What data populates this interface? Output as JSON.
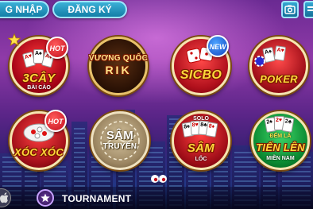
{
  "header": {
    "login_label": "G NHẬP",
    "register_label": "ĐĂNG KÝ"
  },
  "games": [
    {
      "id": "3cay",
      "title": "3CÂY",
      "subtitle": "BÀI CÀO",
      "badge": "HOT"
    },
    {
      "id": "vuong-quoc-rik",
      "title": "VƯƠNG QUỐC",
      "subtitle": "RIK"
    },
    {
      "id": "sicbo",
      "title": "SICBO",
      "badge": "NEW"
    },
    {
      "id": "poker",
      "title": "POKER"
    },
    {
      "id": "xoc-xoc",
      "title": "XÓC XÓC",
      "badge": "HOT"
    },
    {
      "id": "sam-truyen",
      "title": "SÂM",
      "subtitle": "TRUYỀN"
    },
    {
      "id": "sam-loc",
      "title": "SÂM",
      "subtitle": "LỐC",
      "top_label": "SOLO"
    },
    {
      "id": "tien-len",
      "title": "TIẾN LÊN",
      "subtitle": "MIỀN NAM",
      "top_label": "ĐẾM LÁ"
    }
  ],
  "bottom": {
    "tournament_label": "TOURNAMENT"
  },
  "colors": {
    "accent": "#ffd83a",
    "button_blue": "#1e94c0",
    "hot_red": "#c30d1d",
    "new_blue": "#1346c0"
  }
}
